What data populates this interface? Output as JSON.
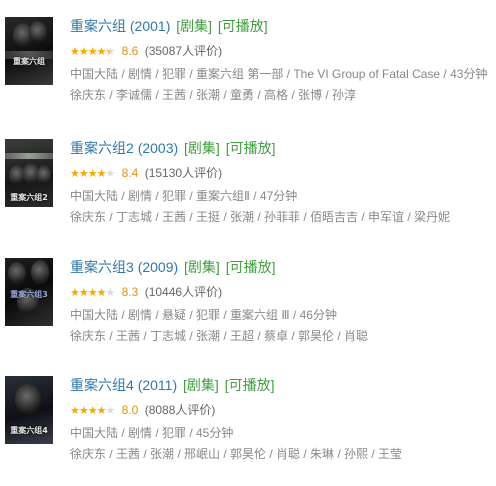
{
  "items": [
    {
      "title": "重案六组",
      "year": "(2001)",
      "tag1": "[剧集]",
      "tag2": "[可播放]",
      "stars_full": "★★★★",
      "stars_empty": "★",
      "rating_value": 4.5,
      "score": "8.6",
      "count": "(35087人评价)",
      "info1": "中国大陆 / 剧情 / 犯罪 / 重案六组 第一部 / The VI Group of Fatal Case / 43分钟",
      "info2": "徐庆东 / 李诚儒 / 王茜 / 张潮 / 童勇 / 高格 / 张博 / 孙淳",
      "poster_text": "重案六组"
    },
    {
      "title": "重案六组2",
      "year": "(2003)",
      "tag1": "[剧集]",
      "tag2": "[可播放]",
      "stars_full": "★★★★",
      "stars_empty": "★",
      "rating_value": 4,
      "score": "8.4",
      "count": "(15130人评价)",
      "info1": "中国大陆 / 剧情 / 犯罪 / 重案六组Ⅱ / 47分钟",
      "info2": "徐庆东 / 丁志城 / 王茜 / 王挺 / 张潮 / 孙菲菲 / 佰晤吉吉 / 申军谊 / 梁丹妮",
      "poster_text": "重案六组2"
    },
    {
      "title": "重案六组3",
      "year": "(2009)",
      "tag1": "[剧集]",
      "tag2": "[可播放]",
      "stars_full": "★★★★",
      "stars_empty": "★",
      "rating_value": 4,
      "score": "8.3",
      "count": "(10446人评价)",
      "info1": "中国大陆 / 剧情 / 悬疑 / 犯罪 / 重案六组 Ⅲ / 46分钟",
      "info2": "徐庆东 / 王茜 / 丁志城 / 张潮 / 王超 / 蔡卓 / 郭昊伦 / 肖聪",
      "poster_text": "重案六组3"
    },
    {
      "title": "重案六组4",
      "year": "(2011)",
      "tag1": "[剧集]",
      "tag2": "[可播放]",
      "stars_full": "★★★★",
      "stars_empty": "★",
      "rating_value": 4,
      "score": "8.0",
      "count": "(8088人评价)",
      "info1": "中国大陆 / 剧情 / 犯罪 / 45分钟",
      "info2": "徐庆东 / 王茜 / 张潮 / 邢岷山 / 郭昊伦 / 肖聪 / 朱琳 / 孙熙 / 王莹",
      "poster_text": "重案六组4"
    }
  ]
}
